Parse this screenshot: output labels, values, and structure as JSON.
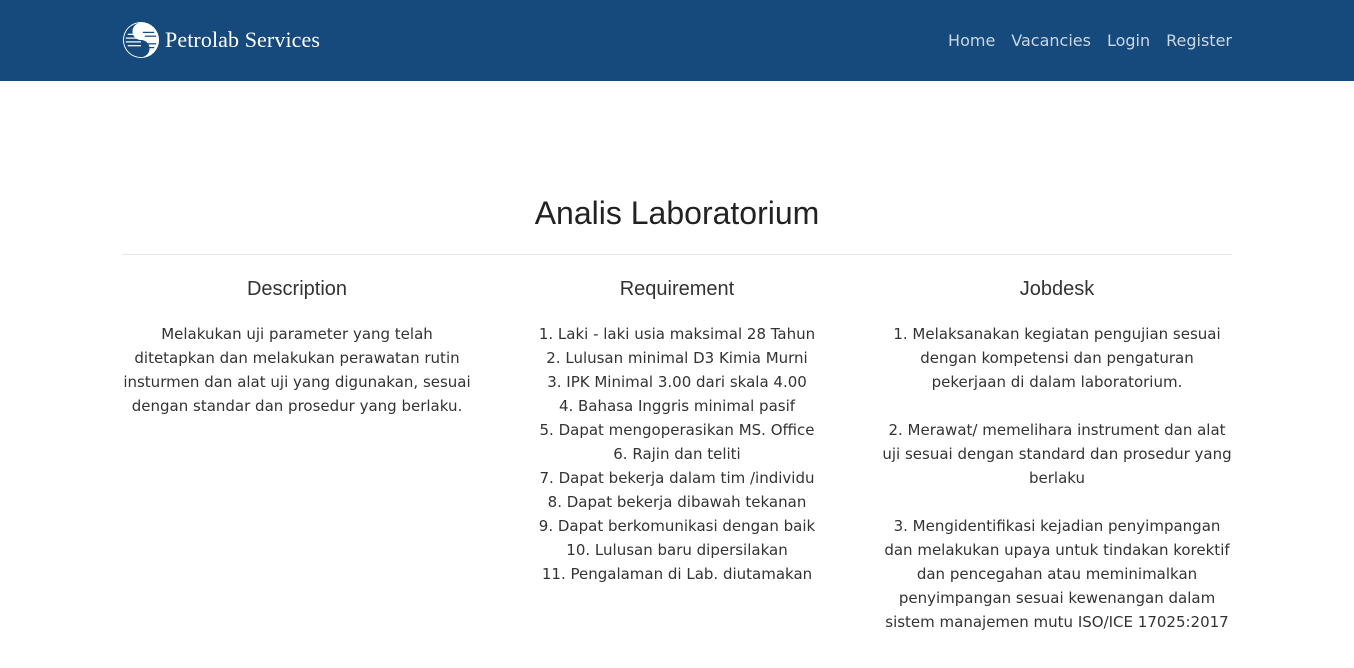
{
  "navbar": {
    "brand": "Petrolab Services",
    "links": [
      "Home",
      "Vacancies",
      "Login",
      "Register"
    ]
  },
  "job": {
    "title": "Analis Laboratorium",
    "description": {
      "heading": "Description",
      "text": "Melakukan uji parameter yang telah ditetapkan dan melakukan perawatan rutin insturmen dan alat uji yang digunakan, sesuai dengan standar dan prosedur yang berlaku."
    },
    "requirement": {
      "heading": "Requirement",
      "items": [
        "1. Laki - laki usia maksimal 28 Tahun",
        "2. Lulusan minimal D3 Kimia Murni",
        "3. IPK Minimal 3.00 dari skala 4.00",
        "4. Bahasa Inggris minimal pasif",
        "5. Dapat mengoperasikan MS. Office",
        "6. Rajin dan teliti",
        "7. Dapat bekerja dalam tim /individu",
        "8. Dapat bekerja dibawah tekanan",
        "9. Dapat berkomunikasi dengan baik",
        "10. Lulusan baru dipersilakan",
        "11. Pengalaman di Lab. diutamakan"
      ]
    },
    "jobdesk": {
      "heading": "Jobdesk",
      "items": [
        "1. Melaksanakan kegiatan pengujian sesuai dengan kompetensi dan pengaturan pekerjaan di dalam laboratorium.",
        "2. Merawat/ memelihara instrument dan alat uji sesuai dengan standard dan prosedur yang berlaku",
        "3. Mengidentifikasi kejadian penyimpangan dan melakukan upaya untuk tindakan korektif dan pencegahan atau meminimalkan penyimpangan sesuai kewenangan dalam sistem manajemen mutu ISO/ICE 17025:2017"
      ]
    }
  },
  "colors": {
    "navbar_bg": "#174a7c",
    "nav_link": "#c9d6e4",
    "text": "#333333"
  },
  "icons": {
    "brand_logo": "petrolab-logo-icon"
  }
}
